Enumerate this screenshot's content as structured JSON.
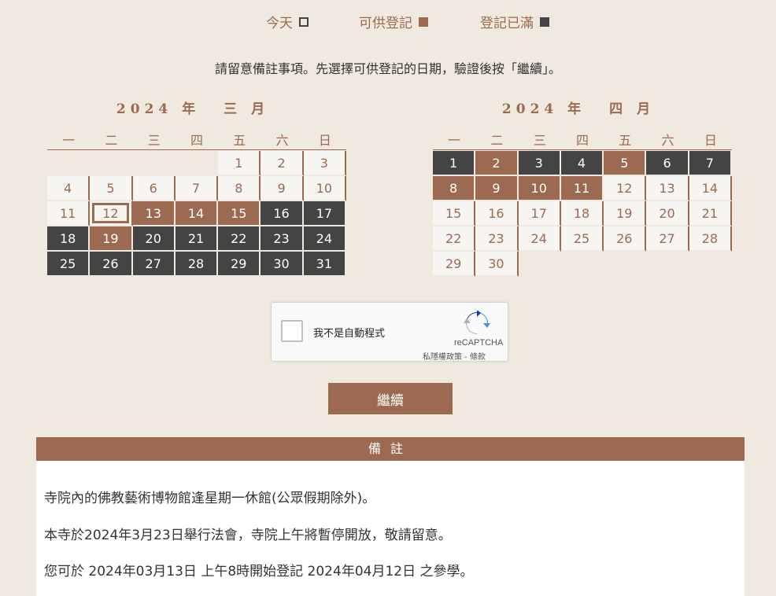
{
  "legend": {
    "today_label": "今天",
    "available_label": "可供登記",
    "full_label": "登記已滿",
    "colors": {
      "available": "#9b6a50",
      "full": "#444444",
      "today_border": "#444444"
    }
  },
  "instruction": "請留意備註事項。先選擇可供登記的日期，驗證後按「繼續」。",
  "calendars": {
    "march": {
      "year": "2024 年",
      "month": "三 月",
      "weekdays": [
        "一",
        "二",
        "三",
        "四",
        "五",
        "六",
        "日"
      ],
      "leading_blanks": 4,
      "days": [
        {
          "d": "1",
          "s": "white"
        },
        {
          "d": "2",
          "s": "white"
        },
        {
          "d": "3",
          "s": "white"
        },
        {
          "d": "4",
          "s": "white"
        },
        {
          "d": "5",
          "s": "white"
        },
        {
          "d": "6",
          "s": "white"
        },
        {
          "d": "7",
          "s": "white"
        },
        {
          "d": "8",
          "s": "white"
        },
        {
          "d": "9",
          "s": "white"
        },
        {
          "d": "10",
          "s": "white"
        },
        {
          "d": "11",
          "s": "white"
        },
        {
          "d": "12",
          "s": "today"
        },
        {
          "d": "13",
          "s": "brown"
        },
        {
          "d": "14",
          "s": "brown"
        },
        {
          "d": "15",
          "s": "brown"
        },
        {
          "d": "16",
          "s": "dark"
        },
        {
          "d": "17",
          "s": "dark"
        },
        {
          "d": "18",
          "s": "dark"
        },
        {
          "d": "19",
          "s": "brown"
        },
        {
          "d": "20",
          "s": "dark"
        },
        {
          "d": "21",
          "s": "dark"
        },
        {
          "d": "22",
          "s": "dark"
        },
        {
          "d": "23",
          "s": "dark"
        },
        {
          "d": "24",
          "s": "dark"
        },
        {
          "d": "25",
          "s": "dark"
        },
        {
          "d": "26",
          "s": "dark"
        },
        {
          "d": "27",
          "s": "dark"
        },
        {
          "d": "28",
          "s": "dark"
        },
        {
          "d": "29",
          "s": "dark"
        },
        {
          "d": "30",
          "s": "dark"
        },
        {
          "d": "31",
          "s": "dark"
        }
      ]
    },
    "april": {
      "year": "2024 年",
      "month": "四 月",
      "weekdays": [
        "一",
        "二",
        "三",
        "四",
        "五",
        "六",
        "日"
      ],
      "leading_blanks": 0,
      "days": [
        {
          "d": "1",
          "s": "dark"
        },
        {
          "d": "2",
          "s": "brown"
        },
        {
          "d": "3",
          "s": "dark"
        },
        {
          "d": "4",
          "s": "dark"
        },
        {
          "d": "5",
          "s": "brown"
        },
        {
          "d": "6",
          "s": "dark"
        },
        {
          "d": "7",
          "s": "dark"
        },
        {
          "d": "8",
          "s": "brown"
        },
        {
          "d": "9",
          "s": "brown"
        },
        {
          "d": "10",
          "s": "brown"
        },
        {
          "d": "11",
          "s": "brown"
        },
        {
          "d": "12",
          "s": "white"
        },
        {
          "d": "13",
          "s": "white"
        },
        {
          "d": "14",
          "s": "white"
        },
        {
          "d": "15",
          "s": "white"
        },
        {
          "d": "16",
          "s": "white"
        },
        {
          "d": "17",
          "s": "white"
        },
        {
          "d": "18",
          "s": "white"
        },
        {
          "d": "19",
          "s": "white"
        },
        {
          "d": "20",
          "s": "white"
        },
        {
          "d": "21",
          "s": "white"
        },
        {
          "d": "22",
          "s": "white"
        },
        {
          "d": "23",
          "s": "white"
        },
        {
          "d": "24",
          "s": "white"
        },
        {
          "d": "25",
          "s": "white"
        },
        {
          "d": "26",
          "s": "white"
        },
        {
          "d": "27",
          "s": "white"
        },
        {
          "d": "28",
          "s": "white"
        },
        {
          "d": "29",
          "s": "white"
        },
        {
          "d": "30",
          "s": "white"
        }
      ]
    }
  },
  "recaptcha": {
    "label": "我不是自動程式",
    "brand": "reCAPTCHA",
    "links": "私隱權政策 - 條款",
    "icon": "recaptcha-logo-icon"
  },
  "continue_button": "繼續",
  "notes": {
    "header": "備註",
    "items": [
      "寺院內的佛教藝術博物館逢星期一休館(公眾假期除外)。",
      "本寺於2024年3月23日舉行法會，寺院上午將暫停開放，敬請留意。",
      "您可於 2024年03月13日 上午8時開始登記 2024年04月12日 之參學。"
    ]
  }
}
